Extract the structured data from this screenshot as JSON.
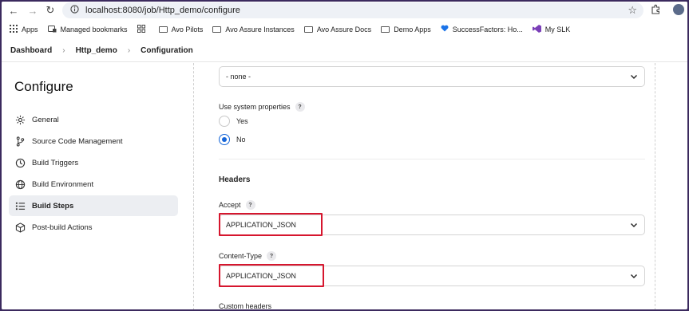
{
  "browser": {
    "url": "localhost:8080/job/Http_demo/configure"
  },
  "bookmarks": [
    {
      "label": "Apps",
      "icon": "apps-grid-icon"
    },
    {
      "label": "Managed bookmarks",
      "icon": "managed-bookmarks-icon"
    },
    {
      "label": "",
      "icon": "grid-icon"
    },
    {
      "label": "Avo Pilots",
      "icon": "folder-icon"
    },
    {
      "label": "Avo Assure Instances",
      "icon": "folder-icon"
    },
    {
      "label": "Avo Assure Docs",
      "icon": "folder-icon"
    },
    {
      "label": "Demo Apps",
      "icon": "folder-icon"
    },
    {
      "label": "SuccessFactors: Ho...",
      "icon": "heart-icon"
    },
    {
      "label": "My SLK",
      "icon": "visual-studio-icon"
    }
  ],
  "breadcrumb": {
    "items": [
      "Dashboard",
      "Http_demo",
      "Configuration"
    ]
  },
  "sidebar": {
    "title": "Configure",
    "items": [
      {
        "label": "General",
        "icon": "gear-icon",
        "active": false
      },
      {
        "label": "Source Code Management",
        "icon": "branch-icon",
        "active": false
      },
      {
        "label": "Build Triggers",
        "icon": "clock-icon",
        "active": false
      },
      {
        "label": "Build Environment",
        "icon": "globe-icon",
        "active": false
      },
      {
        "label": "Build Steps",
        "icon": "list-icon",
        "active": true
      },
      {
        "label": "Post-build Actions",
        "icon": "package-icon",
        "active": false
      }
    ]
  },
  "main": {
    "top_select_value": "- none -",
    "use_system_properties": {
      "label": "Use system properties",
      "help": "?",
      "options": [
        "Yes",
        "No"
      ],
      "selected": "No"
    },
    "headers_title": "Headers",
    "accept": {
      "label": "Accept",
      "help": "?",
      "value": "APPLICATION_JSON"
    },
    "content_type": {
      "label": "Content-Type",
      "help": "?",
      "value": "APPLICATION_JSON"
    },
    "custom_headers_label": "Custom headers"
  },
  "colors": {
    "highlight": "#d6162e",
    "radio_accent": "#1565d8",
    "frame": "#3b2a5e"
  }
}
